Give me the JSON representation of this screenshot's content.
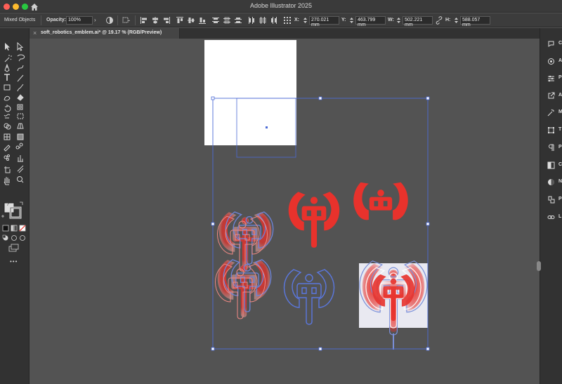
{
  "window": {
    "title": "Adobe Illustrator 2025"
  },
  "control_bar": {
    "selection_type": "Mixed Objects",
    "opacity_label": "Opacity:",
    "opacity_value": "100%",
    "x_label": "X:",
    "x_value": "270.021 mm",
    "y_label": "Y:",
    "y_value": "463.799 mm",
    "w_label": "W:",
    "w_value": "502.221 mm",
    "h_label": "H:",
    "h_value": "588.057 mm"
  },
  "document_tab": {
    "title": "soft_robotics_emblem.ai* @ 19.17 % (RGB/Preview)",
    "close": "×"
  },
  "toolbar": {
    "more_label": "•••",
    "unknown_fill": "?"
  },
  "right_panel": {
    "items": [
      {
        "icon": "color-panel-icon",
        "letter": "C"
      },
      {
        "icon": "appearance-icon",
        "letter": "A"
      },
      {
        "icon": "properties-icon",
        "letter": "P"
      },
      {
        "icon": "export-icon",
        "letter": "A"
      },
      {
        "icon": "magic-icon",
        "letter": "M"
      },
      {
        "icon": "transform-icon",
        "letter": "T"
      },
      {
        "icon": "paragraph-icon",
        "letter": "P"
      },
      {
        "icon": "layers-icon",
        "letter": "C"
      },
      {
        "icon": "color-guide-icon",
        "letter": "N"
      },
      {
        "icon": "pathfinder-icon",
        "letter": "P"
      },
      {
        "icon": "links-icon",
        "letter": "L"
      }
    ]
  },
  "colors": {
    "accent_red": "#e8322c",
    "selection_blue": "#4d6bd6",
    "canvas_bg": "#535353",
    "panel_bg": "#323232"
  }
}
